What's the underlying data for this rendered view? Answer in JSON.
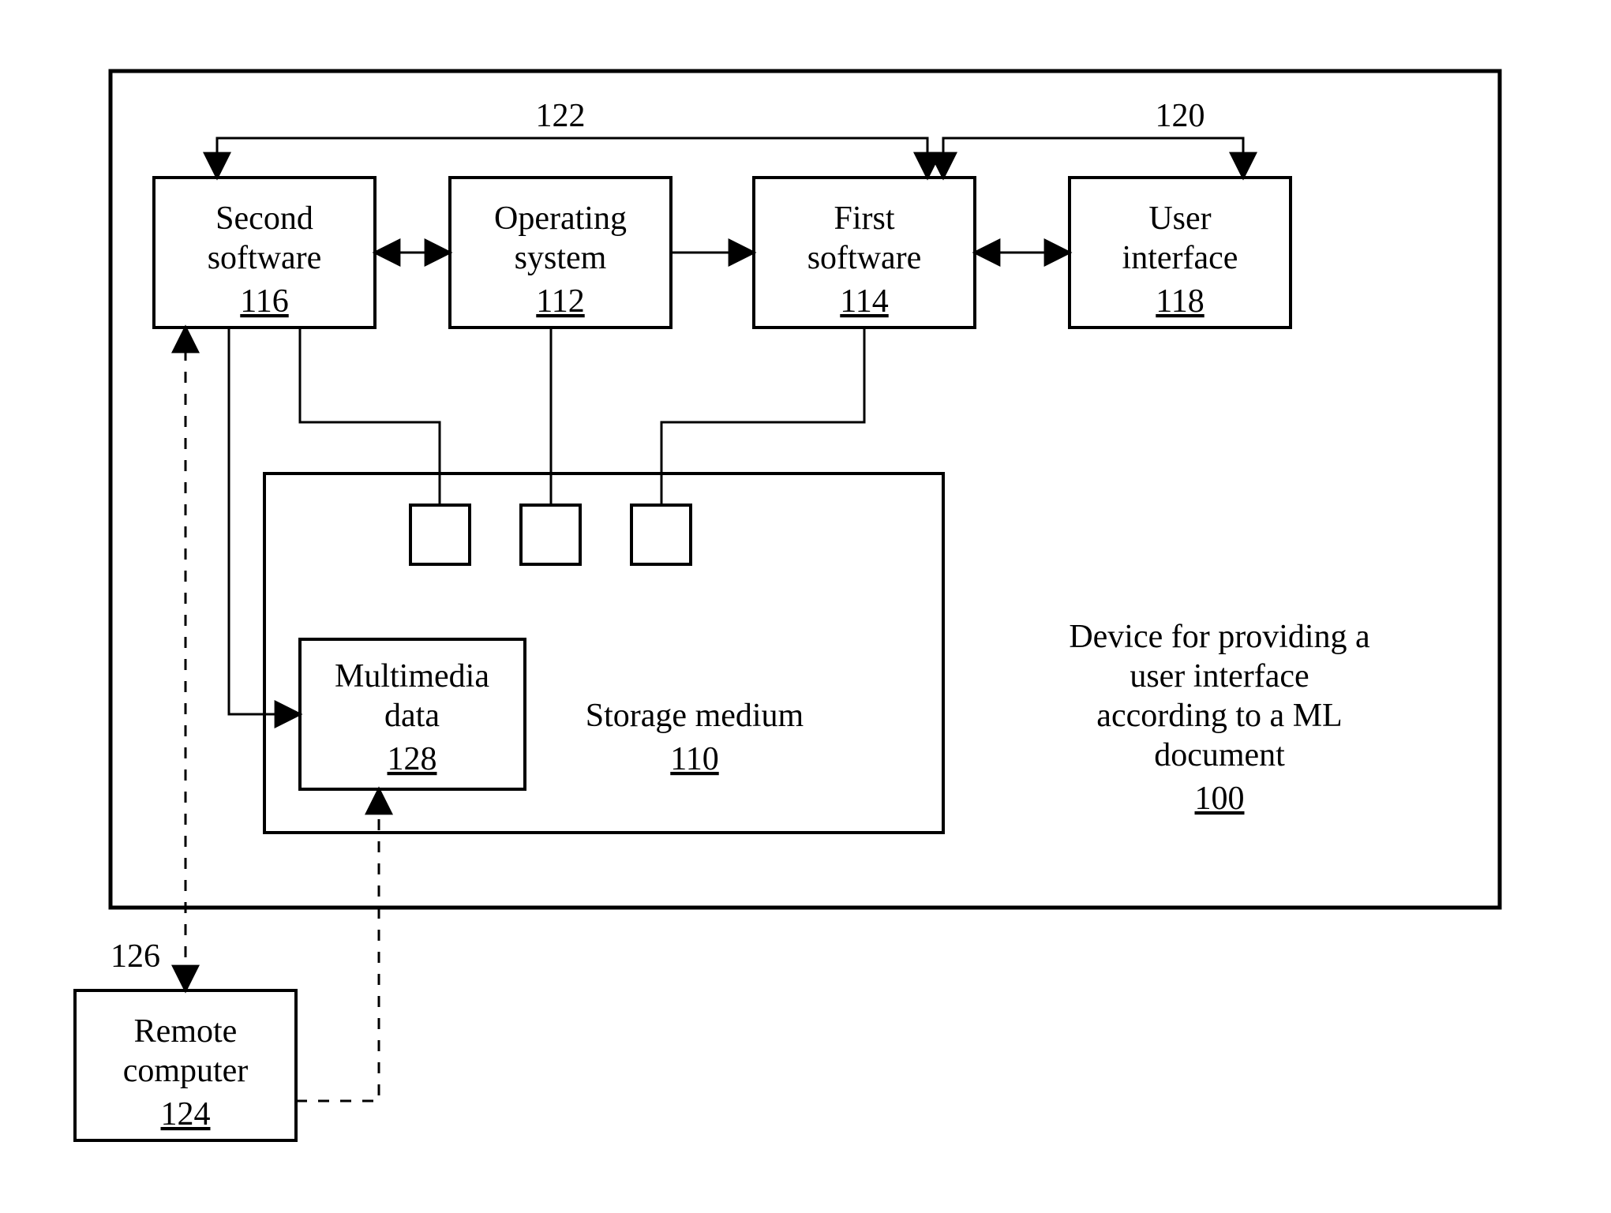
{
  "blocks": {
    "second_software": {
      "line1": "Second",
      "line2": "software",
      "ref": "116"
    },
    "operating_system": {
      "line1": "Operating",
      "line2": "system",
      "ref": "112"
    },
    "first_software": {
      "line1": "First",
      "line2": "software",
      "ref": "114"
    },
    "user_interface": {
      "line1": "User",
      "line2": "interface",
      "ref": "118"
    },
    "multimedia_data": {
      "line1": "Multimedia",
      "line2": "data",
      "ref": "128"
    },
    "storage_medium": {
      "line1": "Storage medium",
      "ref": "110"
    },
    "device_caption": {
      "l1": "Device for providing a",
      "l2": "user interface",
      "l3": "according to a ML",
      "l4": "document",
      "ref": "100"
    },
    "remote_computer": {
      "line1": "Remote",
      "line2": "computer",
      "ref": "124"
    }
  },
  "labels": {
    "top_left": "122",
    "top_right": "120",
    "bottom_left": "126"
  }
}
